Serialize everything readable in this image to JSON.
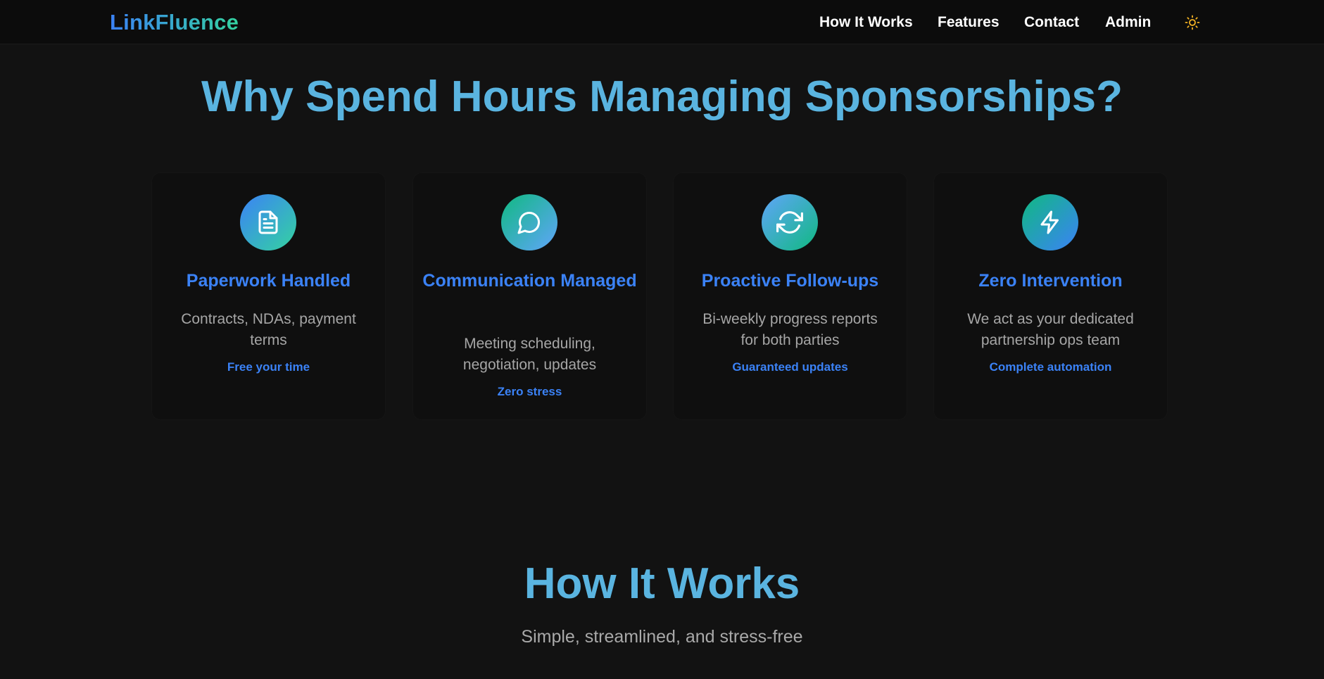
{
  "nav": {
    "logo": "LinkFluence",
    "links": [
      "How It Works",
      "Features",
      "Contact",
      "Admin"
    ],
    "theme_icon": "sun-icon"
  },
  "why_section": {
    "title": "Why Spend Hours Managing Sponsorships?",
    "cards": [
      {
        "icon": "document-icon",
        "title": "Paperwork Handled",
        "description": "Contracts, NDAs, payment terms",
        "tag": "Free your time"
      },
      {
        "icon": "chat-bubble-icon",
        "title": "Communication Managed",
        "description": "Meeting scheduling, negotiation, updates",
        "tag": "Zero stress"
      },
      {
        "icon": "refresh-icon",
        "title": "Proactive Follow-ups",
        "description": "Bi-weekly progress reports for both parties",
        "tag": "Guaranteed updates"
      },
      {
        "icon": "lightning-icon",
        "title": "Zero Intervention",
        "description": "We act as your dedicated partnership ops team",
        "tag": "Complete automation"
      }
    ]
  },
  "how_section": {
    "title": "How It Works",
    "subtitle": "Simple, streamlined, and stress-free"
  },
  "colors": {
    "background": "#121212",
    "heading": "#5ab4e0",
    "accent_blue": "#3b82f6",
    "accent_green": "#34d3a0",
    "theme_icon": "#f5b323"
  }
}
